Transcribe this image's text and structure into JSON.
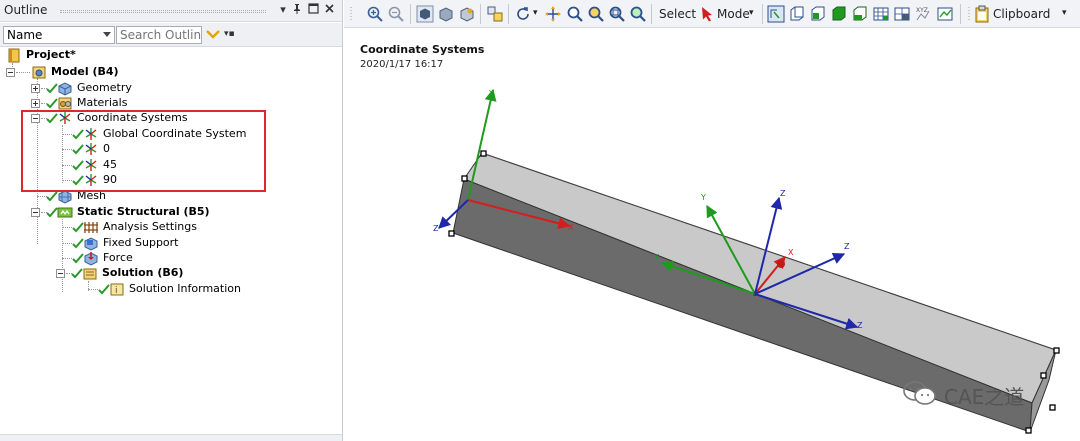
{
  "outline": {
    "title": "Outline",
    "pin_glyph": "▾ ⊣",
    "filter_select": "Name",
    "search_placeholder": "Search Outline"
  },
  "tree": {
    "project": "Project*",
    "model": "Model (B4)",
    "geometry": "Geometry",
    "materials": "Materials",
    "coord_systems": "Coordinate Systems",
    "cs_global": "Global Coordinate System",
    "cs_0": "0",
    "cs_45": "45",
    "cs_90": "90",
    "mesh": "Mesh",
    "static": "Static Structural (B5)",
    "analysis_settings": "Analysis Settings",
    "fixed_support": "Fixed Support",
    "force": "Force",
    "solution": "Solution (B6)",
    "solution_info": "Solution Information"
  },
  "toolbar": {
    "select_label": "Select",
    "mode_label": "Mode",
    "clipboard_label": "Clipboard"
  },
  "viewport": {
    "title": "Coordinate Systems",
    "date": "2020/1/17 16:17",
    "axis_labels": {
      "x": "X",
      "y": "Y",
      "z": "Z"
    }
  },
  "watermark": {
    "text": "CAE之道"
  },
  "colors": {
    "highlight": "#e0262f",
    "axis_x": "#d21e1e",
    "axis_y": "#1f9a1f",
    "axis_z": "#1e28a8",
    "beam_top": "#c9c9c9",
    "beam_side": "#6b6b6b",
    "check": "#2a9a2a"
  }
}
